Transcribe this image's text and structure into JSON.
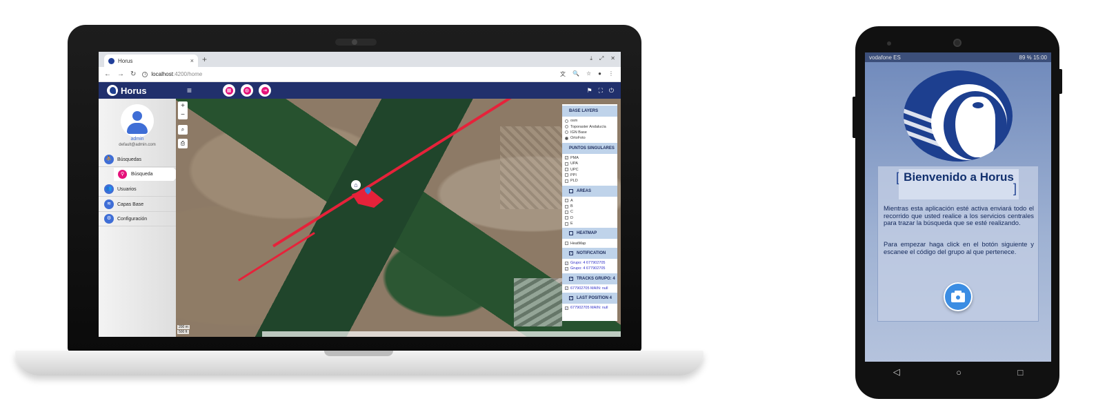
{
  "browser": {
    "tab_title": "Horus",
    "tab_close": "×",
    "new_tab": "+",
    "window_controls": [
      "⤓",
      "⤢",
      "✕"
    ],
    "nav_back": "←",
    "nav_forward": "→",
    "nav_reload": "↻",
    "url_host": "localhost",
    "url_path": ":4200/home",
    "toolbar_icons": [
      "文",
      "🔍",
      "☆",
      "●",
      "⋮"
    ]
  },
  "app": {
    "title": "Horus",
    "menu_icon": "≡",
    "header_buttons": [
      "▦",
      "◍",
      "⇥"
    ],
    "header_right_icons": [
      "⚑",
      "⛶",
      "⏻"
    ]
  },
  "sidebar": {
    "user_name": "admin",
    "user_email": "default@admin.com",
    "items": [
      {
        "label": "Búsquedas",
        "icon": "walk-icon"
      },
      {
        "label": "Usuarios",
        "icon": "users-icon"
      },
      {
        "label": "Capas Base",
        "icon": "layers-icon"
      },
      {
        "label": "Configuración",
        "icon": "gear-icon"
      }
    ],
    "sub_item": {
      "label": "Búsqueda",
      "icon": "location-pin-icon"
    }
  },
  "map": {
    "zoom_in": "+",
    "zoom_out": "−",
    "search_btn": "⌕",
    "print_btn": "⎙",
    "scale_1": "200 m",
    "scale_2": "500 ft",
    "layers": {
      "base_layers_title": "Base Layers",
      "base_layers": [
        "osm",
        "Toporaster Andalucía",
        "IGN Base",
        "OrtoFoto"
      ],
      "base_selected": "OrtoFoto",
      "puntos_title": "Puntos Singulares",
      "puntos": [
        "PMA",
        "UPA",
        "UPC",
        "PPI",
        "PLD"
      ],
      "areas_title": "Areas",
      "areas": [
        "A",
        "B",
        "C",
        "D",
        "E"
      ],
      "heatmap_title": "HeatMap",
      "heatmap_items": [
        "HeatMap"
      ],
      "notification_title": "Notification",
      "notification_items": [
        "Grupo: 4 677902705",
        "Grupo: 4 677902705"
      ],
      "tracks_title": "Tracks Grupo: 4",
      "tracks_items": [
        "677902705 MAIN: null"
      ],
      "lastpos_title": "Last Position 4",
      "lastpos_items": [
        "677902705 MAIN: null"
      ]
    }
  },
  "phone": {
    "carrier": "vodafone ES",
    "status_right": "89 %  15:00",
    "welcome_title": "Bienvenido a Horus",
    "bracket_left": "[",
    "bracket_right": "]",
    "paragraph_1": "Mientras esta aplicación esté activa enviará todo el recorrido que usted realice a los servicios centrales para trazar la búsqueda que se esté realizando.",
    "paragraph_2": "Para empezar haga click en el botón siguiente y escanee el código del grupo al que pertenece.",
    "nav": [
      "◁",
      "○",
      "□"
    ]
  },
  "colors": {
    "header": "#21306c",
    "accent_blue": "#3f6ed6",
    "accent_pink": "#e5117a",
    "route_red": "#e6223a",
    "phone_bg": "#9fb2d3"
  }
}
